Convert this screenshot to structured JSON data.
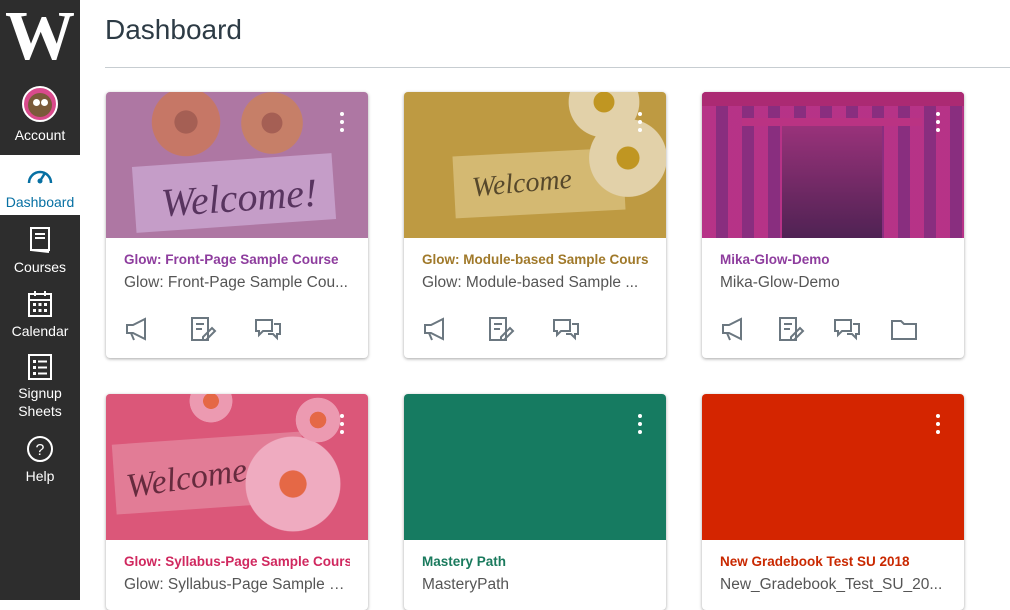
{
  "nav": {
    "logo": "W",
    "account": "Account",
    "dashboard": "Dashboard",
    "courses": "Courses",
    "calendar": "Calendar",
    "signup": "Signup Sheets",
    "help": "Help"
  },
  "header": {
    "title": "Dashboard"
  },
  "cards": [
    {
      "title": "Glow: Front-Page Sample Course",
      "subtitle": "Glow: Front-Page Sample Cou...",
      "color": "#8e3d9e",
      "sign_text": "Welcome!"
    },
    {
      "title": "Glow: Module-based Sample Course",
      "subtitle": "Glow: Module-based Sample ...",
      "color": "#a0792a",
      "sign_text": "Welcome"
    },
    {
      "title": "Mika-Glow-Demo",
      "subtitle": "Mika-Glow-Demo",
      "color": "#8e3d9e"
    },
    {
      "title": "Glow: Syllabus-Page Sample Course",
      "subtitle": "Glow: Syllabus-Page Sample C...",
      "color": "#d0285f",
      "sign_text": "Welcome"
    },
    {
      "title": "Mastery Path",
      "subtitle": "MasteryPath",
      "color": "#1a7a5d"
    },
    {
      "title": "New Gradebook Test SU 2018",
      "subtitle": "New_Gradebook_Test_SU_20...",
      "color": "#c92800"
    }
  ]
}
